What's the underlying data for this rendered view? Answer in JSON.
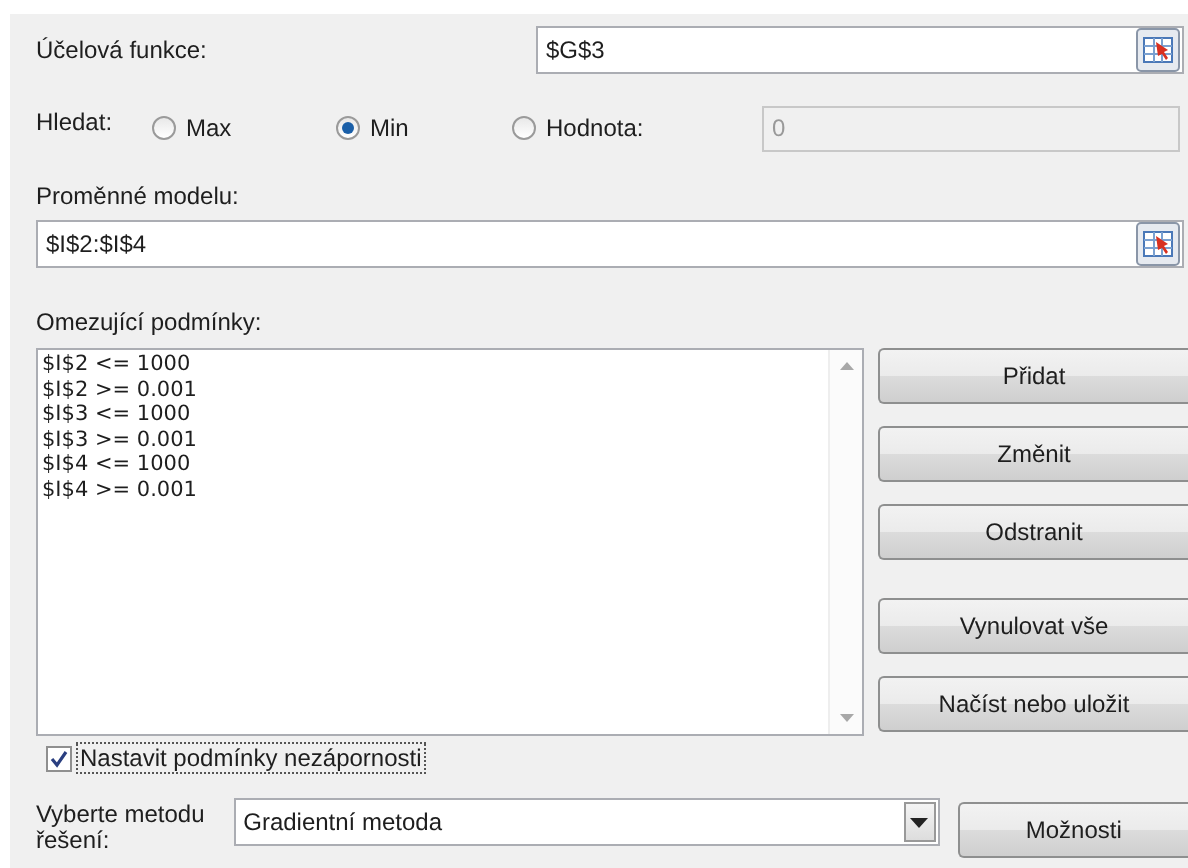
{
  "objective": {
    "label": "Účelová funkce:",
    "value": "$G$3"
  },
  "goal": {
    "label": "Hledat:",
    "options": [
      {
        "label": "Max",
        "selected": false
      },
      {
        "label": "Min",
        "selected": true
      },
      {
        "label": "Hodnota:",
        "selected": false
      }
    ],
    "value": "0"
  },
  "variables": {
    "label": "Proměnné modelu:",
    "value": "$I$2:$I$4"
  },
  "constraints": {
    "label": "Omezující podmínky:",
    "items": [
      "$I$2 <= 1000",
      "$I$2 >= 0.001",
      "$I$3 <= 1000",
      "$I$3 >= 0.001",
      "$I$4 <= 1000",
      "$I$4 >= 0.001"
    ]
  },
  "buttons": [
    {
      "label": "Přidat",
      "gap": false
    },
    {
      "label": "Změnit",
      "gap": false
    },
    {
      "label": "Odstranit",
      "gap": false
    },
    {
      "label": "Vynulovat vše",
      "gap": true
    },
    {
      "label": "Načíst nebo uložit",
      "gap": false
    }
  ],
  "nonnegative": {
    "label": "Nastavit podmínky nezápornosti",
    "checked": true
  },
  "method": {
    "label": "Vyberte metodu řešení:",
    "value": "Gradientní metoda"
  },
  "options_button": "Možnosti"
}
